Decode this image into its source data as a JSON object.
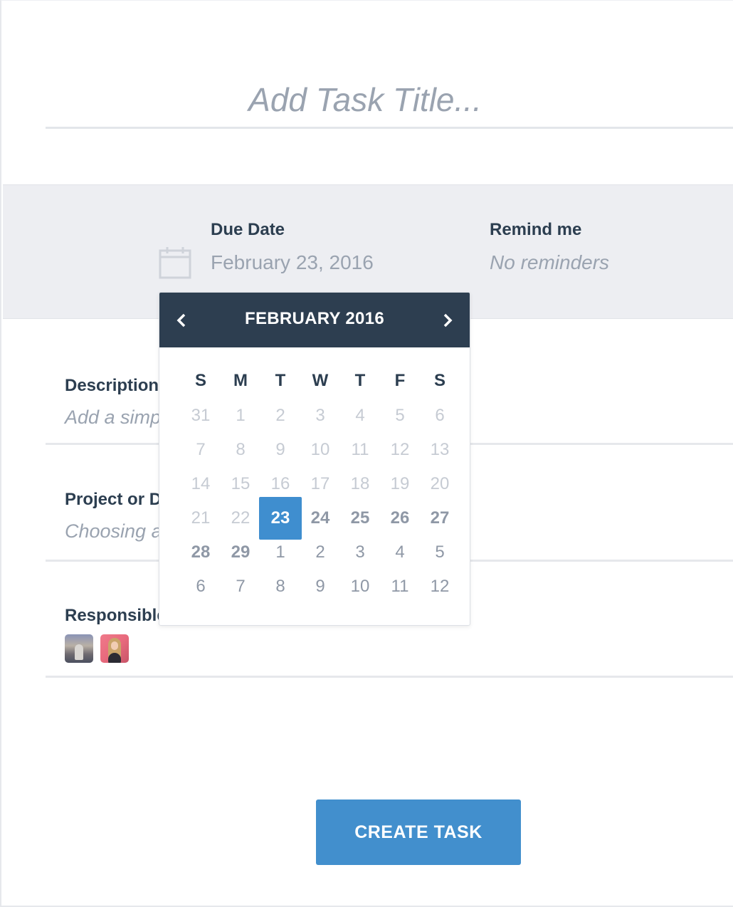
{
  "title": {
    "placeholder": "Add Task Title..."
  },
  "due_date": {
    "label": "Due Date",
    "value": "February 23, 2016",
    "icon": "calendar-icon"
  },
  "remind": {
    "label": "Remind me",
    "value": "No reminders"
  },
  "description": {
    "label": "Description",
    "placeholder": "Add a simp"
  },
  "project": {
    "label": "Project or D",
    "placeholder": "Choosing a"
  },
  "responsible": {
    "label": "Responsible",
    "avatars": [
      "user-avatar",
      "user-avatar"
    ]
  },
  "create_button": {
    "label": "CREATE TASK",
    "color": "#428fcd"
  },
  "calendar": {
    "month_label": "FEBRUARY 2016",
    "weekdays": [
      "S",
      "M",
      "T",
      "W",
      "T",
      "F",
      "S"
    ],
    "weeks": [
      [
        "31",
        "1",
        "2",
        "3",
        "4",
        "5",
        "6"
      ],
      [
        "7",
        "8",
        "9",
        "10",
        "11",
        "12",
        "13"
      ],
      [
        "14",
        "15",
        "16",
        "17",
        "18",
        "19",
        "20"
      ],
      [
        "21",
        "22",
        "23",
        "24",
        "25",
        "26",
        "27"
      ],
      [
        "28",
        "29",
        "1",
        "2",
        "3",
        "4",
        "5"
      ],
      [
        "6",
        "7",
        "8",
        "9",
        "10",
        "11",
        "12"
      ]
    ],
    "selected": "23",
    "header_color": "#2d3e50",
    "selected_color": "#3f8ecf"
  }
}
